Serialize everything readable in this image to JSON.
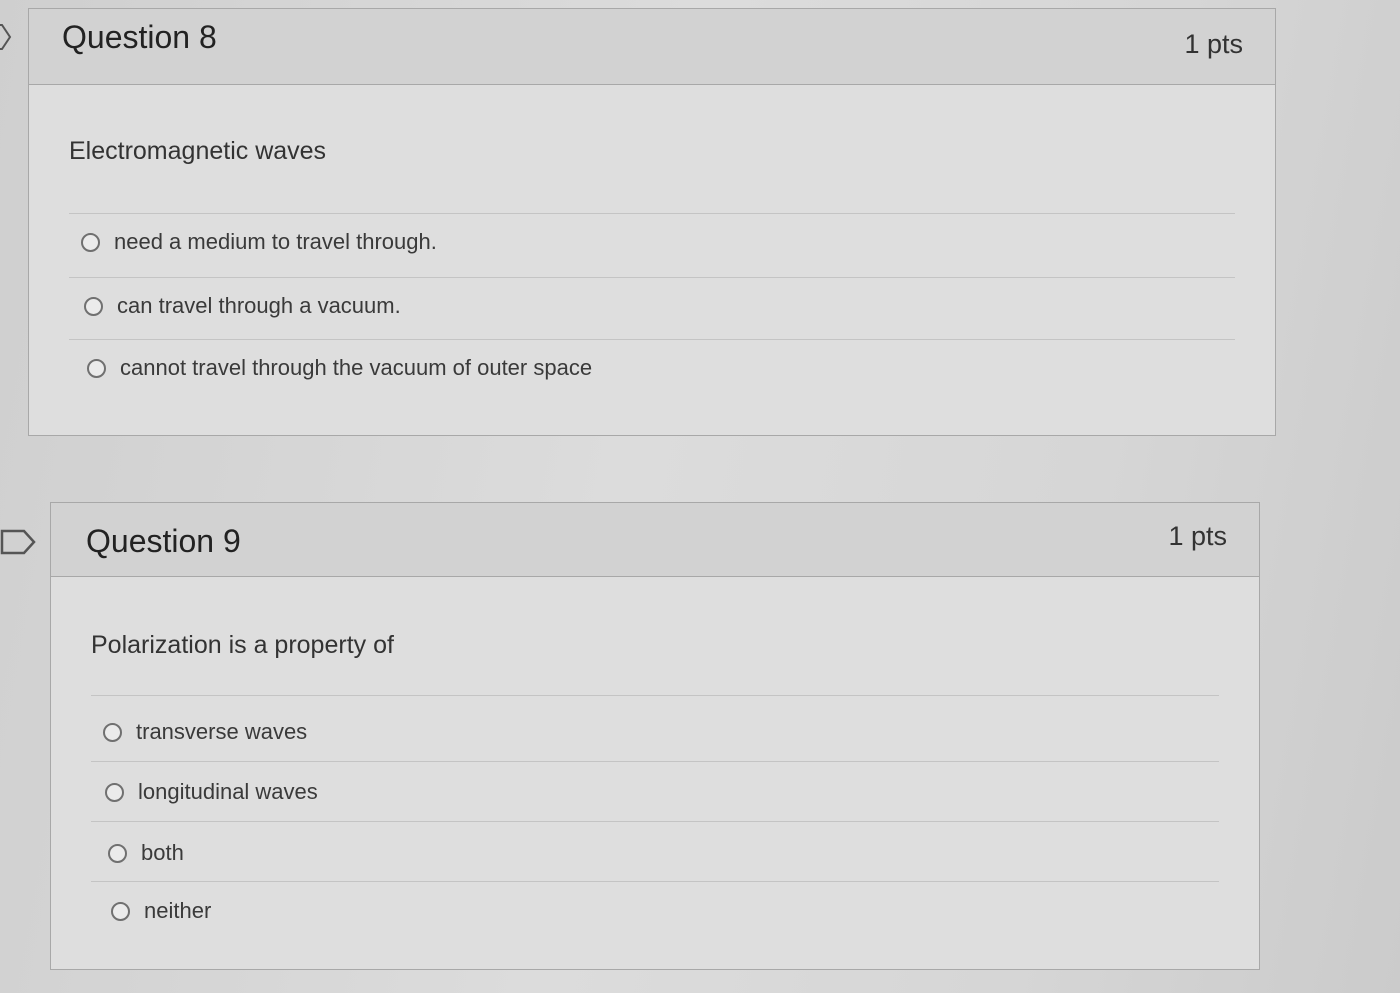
{
  "questions": [
    {
      "title": "Question 8",
      "points": "1 pts",
      "text": "Electromagnetic waves",
      "answers": [
        "need a medium to travel through.",
        "can travel through a vacuum.",
        "cannot travel through the vacuum of outer space"
      ]
    },
    {
      "title": "Question 9",
      "points": "1 pts",
      "text": "Polarization is a property of",
      "answers": [
        "transverse waves",
        "longitudinal waves",
        "both",
        "neither"
      ]
    }
  ]
}
